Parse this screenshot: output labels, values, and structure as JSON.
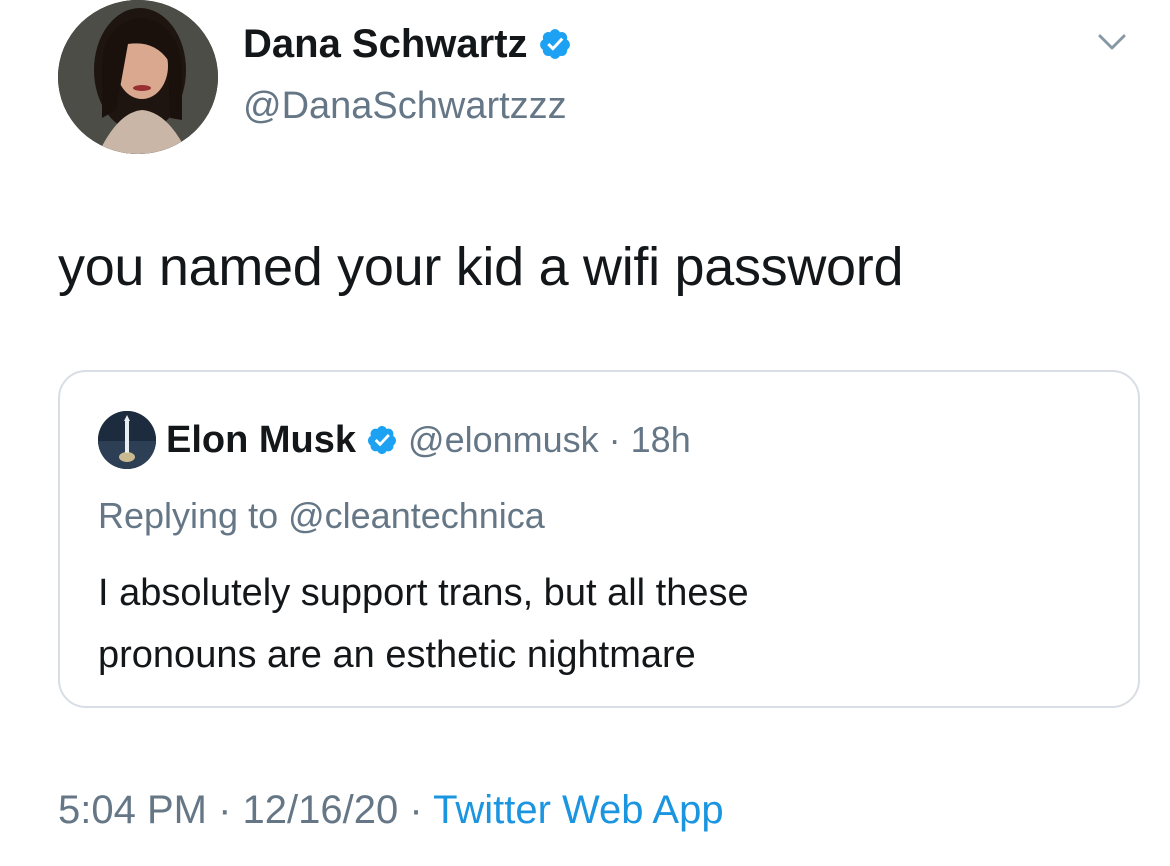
{
  "author": {
    "name": "Dana Schwartz",
    "handle": "@DanaSchwartzzz",
    "verified": true
  },
  "tweet": {
    "text": "you named your kid a wifi password"
  },
  "quoted_tweet": {
    "name": "Elon Musk",
    "handle": "@elonmusk",
    "separator": "·",
    "time": "18h",
    "replying_to": "Replying to @cleantechnica",
    "text_line_1": "I absolutely support trans, but all these",
    "text_line_2": "pronouns are an esthetic nightmare"
  },
  "footer": {
    "time": "5:04 PM",
    "sep1": "·",
    "date": "12/16/20",
    "sep2": "·",
    "source": "Twitter Web App"
  },
  "colors": {
    "verified_badge": "#1da1f2",
    "link": "#1b95e0",
    "secondary_text": "#657786",
    "border": "#d8dee3"
  },
  "icons": {
    "verified": "verified-badge-icon",
    "menu": "chevron-down-icon"
  }
}
